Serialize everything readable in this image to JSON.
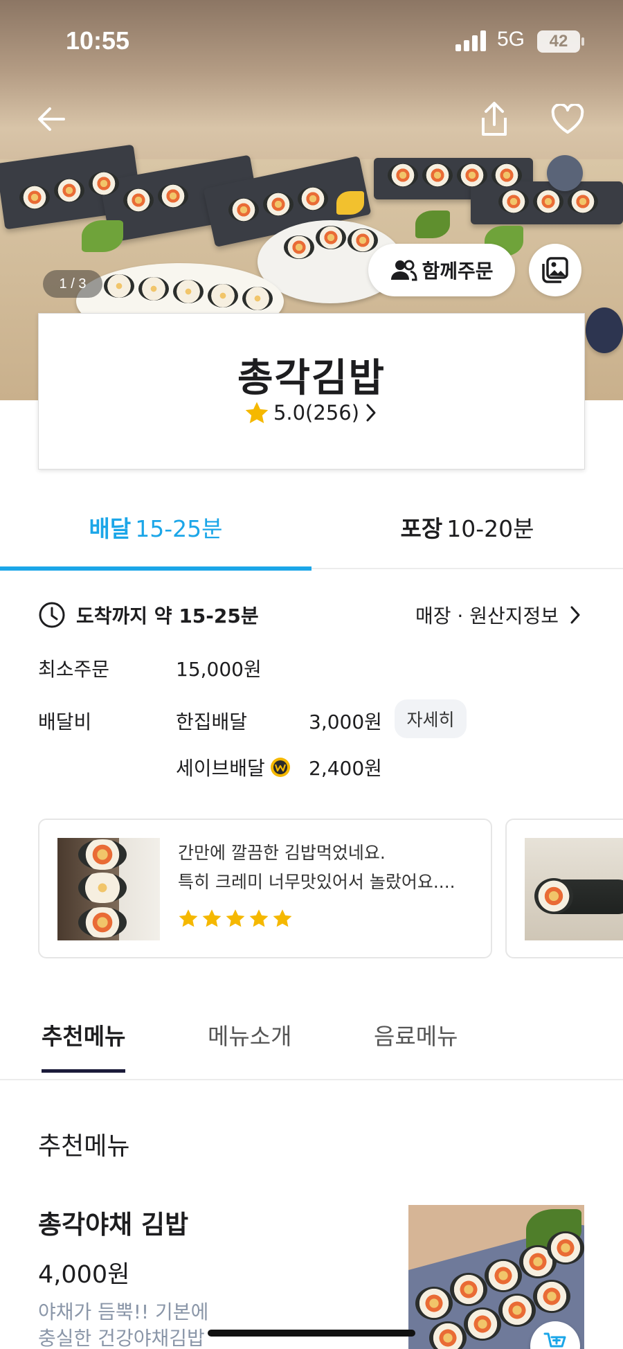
{
  "status_bar": {
    "time": "10:55",
    "network": "5G",
    "battery": "42"
  },
  "hero": {
    "photo_counter": "1 / 3",
    "group_order_label": "함께주문"
  },
  "store": {
    "name": "총각김밥",
    "rating": "5.0(256)"
  },
  "delivery_tabs": [
    {
      "label": "배달",
      "time": "15-25분",
      "active": true
    },
    {
      "label": "포장",
      "time": "10-20분",
      "active": false
    }
  ],
  "info": {
    "arrival_prefix": "도착까지 약",
    "arrival_time": "15-25분",
    "store_info_link": "매장 · 원산지정보",
    "min_order_label": "최소주문",
    "min_order_value": "15,000원",
    "delivery_fee_label": "배달비",
    "single_delivery_label": "한집배달",
    "single_delivery_fee": "3,000원",
    "detail_button": "자세히",
    "save_delivery_label": "세이브배달",
    "save_delivery_fee": "2,400원"
  },
  "reviews": [
    {
      "text_line1": "간만에 깔끔한 김밥먹었네요.",
      "text_line2": "특히 크레미  너무맛있어서 놀랐어요....",
      "stars": 5
    }
  ],
  "menu_tabs": [
    {
      "label": "추천메뉴",
      "active": true
    },
    {
      "label": "메뉴소개",
      "active": false
    },
    {
      "label": "음료메뉴",
      "active": false
    }
  ],
  "menu_section": {
    "title": "추천메뉴",
    "items": [
      {
        "name": "총각야채 김밥",
        "price": "4,000원",
        "desc_line1": "야채가 듬뿍!! 기본에",
        "desc_line2": "충실한 건강야채김밥"
      }
    ]
  },
  "colors": {
    "accent": "#1ba6e8",
    "star": "#f5b800",
    "text": "#1d1d1f",
    "muted": "#8a96a8"
  }
}
